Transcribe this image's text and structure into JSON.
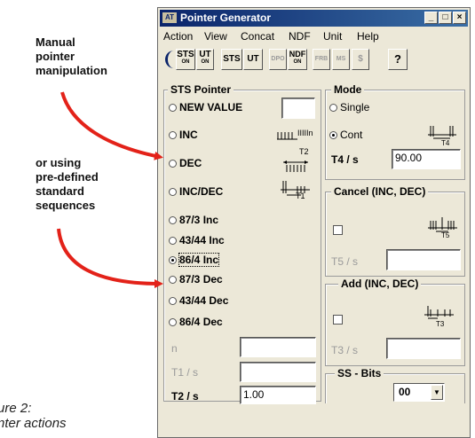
{
  "annotations": {
    "manual": [
      "Manual",
      "pointer",
      "manipulation"
    ],
    "standard": [
      "or using",
      "pre-defined",
      "standard",
      "sequences"
    ],
    "caption": [
      "ure 2:",
      "nter actions"
    ]
  },
  "window": {
    "title": "Pointer Generator",
    "app_icon_text": "AT",
    "controls": {
      "minimize": "_",
      "maximize": "□",
      "close": "×"
    }
  },
  "menu": [
    "Action",
    "View",
    "Concat",
    "NDF",
    "Unit",
    "Help"
  ],
  "toolbar": {
    "sts_on": "STS",
    "sts_on_sub": "ON",
    "ut_on": "UT",
    "ut_on_sub": "ON",
    "sts": "STS",
    "ut": "UT",
    "dpo": "DPO",
    "ndf": "NDF",
    "ndf_sub": "ON",
    "frb": "FRB",
    "ms": "MS",
    "s": "$",
    "help": "?"
  },
  "sts_pointer": {
    "label": "STS Pointer",
    "options": [
      {
        "label": "NEW VALUE",
        "selected": false
      },
      {
        "label": "INC",
        "selected": false
      },
      {
        "label": "DEC",
        "selected": false
      },
      {
        "label": "INC/DEC",
        "selected": false
      },
      {
        "label": "87/3 Inc",
        "selected": false
      },
      {
        "label": "43/44 Inc",
        "selected": false
      },
      {
        "label": "86/4 Inc",
        "selected": true
      },
      {
        "label": "87/3 Dec",
        "selected": false
      },
      {
        "label": "43/44 Dec",
        "selected": false
      },
      {
        "label": "86/4 Dec",
        "selected": false
      }
    ],
    "new_value": "",
    "n_label": "n",
    "n_value": "",
    "t1_label": "T1 / s",
    "t1_value": "",
    "t2_label": "T2 / s",
    "t2_value": "1.00",
    "diagrams": {
      "inc": "IIIIIn",
      "dec_t2": "T2",
      "incdec_t1": "T1"
    }
  },
  "mode": {
    "label": "Mode",
    "single": "Single",
    "cont": "Cont",
    "selected": "Cont",
    "t4_label": "T4 / s",
    "t4_value": "90.00",
    "diagram": "T4"
  },
  "cancel": {
    "label": "Cancel (INC, DEC)",
    "checked": false,
    "t5_label": "T5 / s",
    "t5_value": "",
    "diagram": "T5"
  },
  "add": {
    "label": "Add (INC, DEC)",
    "checked": false,
    "t3_label": "T3 / s",
    "t3_value": "",
    "diagram": "T3"
  },
  "ss_bits": {
    "label": "SS - Bits",
    "value": "00"
  },
  "colors": {
    "arrow": "#e32219",
    "title_bar": "#0a246a",
    "face": "#ece8d8"
  }
}
